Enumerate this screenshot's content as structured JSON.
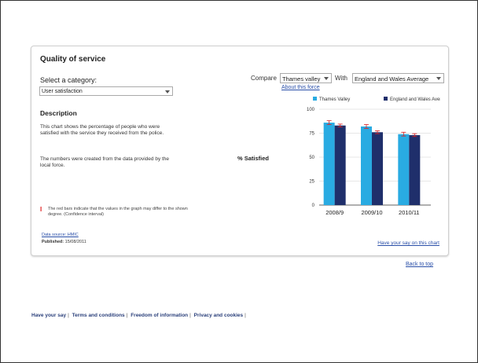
{
  "card": {
    "title": "Quality of service",
    "category_label": "Select a category:",
    "category_value": "User satisfaction",
    "description_heading": "Description",
    "description_p1": "This chart shows the percentage of people who were satisfied with the service they received from the police.",
    "description_p2": "The numbers were created from the data provided by the local force.",
    "note": "The red bars indicate that the values in the graph may differ to the shown degree. (Confidence interval)",
    "data_source": "Data source: HMIC",
    "published_label": "Published:",
    "published_date": "15/08/2011",
    "have_your_say_chart": "Have your say on this chart"
  },
  "compare": {
    "label": "Compare",
    "force_value": "Thames valley",
    "with_label": "With",
    "with_value": "England and Wales Average",
    "about_link": "About this force"
  },
  "chart_data": {
    "type": "bar",
    "categories": [
      "2008/9",
      "2009/10",
      "2010/11"
    ],
    "series": [
      {
        "name": "Thames Valley",
        "values": [
          86,
          82,
          74
        ],
        "color": "#29abe2",
        "ci": [
          2,
          2,
          2
        ]
      },
      {
        "name": "England and Wales Average",
        "values": [
          83,
          76,
          73
        ],
        "color": "#1f2f6b",
        "ci": [
          1.5,
          1.5,
          1.5
        ]
      }
    ],
    "ylabel": "% Satisfied",
    "ylim": [
      0,
      100
    ],
    "yticks": [
      "0",
      "25",
      "50",
      "75",
      "100"
    ],
    "error_bar_color": "#e02020"
  },
  "back_to_top": "Back to top",
  "footer": {
    "links": [
      "Have your say",
      "Terms and conditions",
      "Freedom of information",
      "Privacy and cookies"
    ]
  }
}
